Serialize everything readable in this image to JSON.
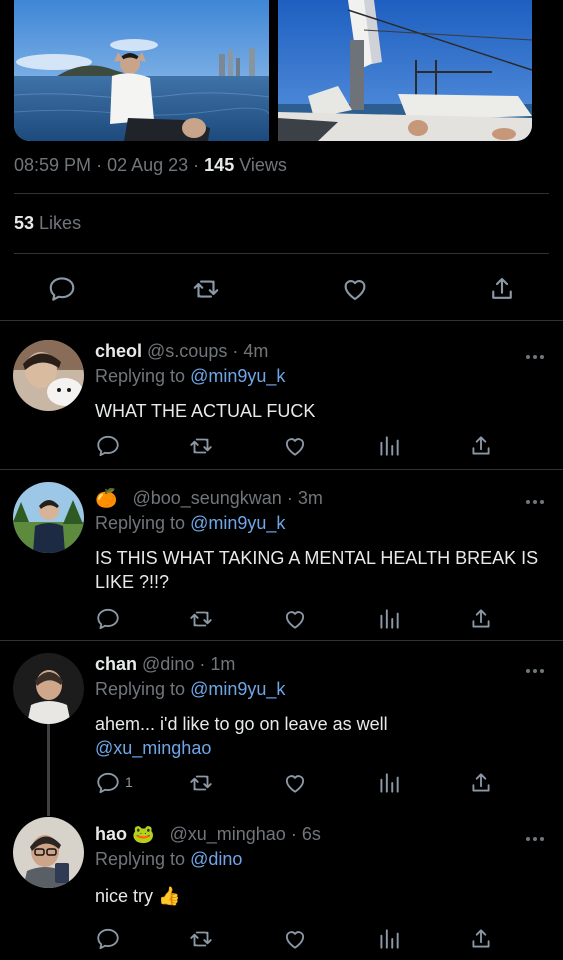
{
  "tweet": {
    "time": "08:59 PM",
    "date": "02 Aug 23",
    "views_count": "145",
    "views_label": "Views",
    "likes_count": "53",
    "likes_label": "Likes"
  },
  "replies": [
    {
      "name": "cheol",
      "handle": "@s.coups",
      "time": "4m",
      "replying_label": "Replying to",
      "replying_to": "@min9yu_k",
      "text": "WHAT THE ACTUAL FUCK"
    },
    {
      "name": "",
      "name_emoji": "🍊",
      "handle": "@boo_seungkwan",
      "time": "3m",
      "replying_label": "Replying to",
      "replying_to": "@min9yu_k",
      "text": "IS THIS WHAT TAKING A MENTAL HEALTH BREAK IS LIKE ?!!?"
    },
    {
      "name": "chan",
      "handle": "@dino",
      "time": "1m",
      "replying_label": "Replying to",
      "replying_to": "@min9yu_k",
      "text": "ahem... i'd like to go on leave as well",
      "mention": "@xu_minghao",
      "reply_count": "1"
    },
    {
      "name": "hao",
      "name_emoji": "🐸",
      "handle": "@xu_minghao",
      "time": "6s",
      "replying_label": "Replying to",
      "replying_to": "@dino",
      "text": "nice try",
      "text_emoji": "👍"
    }
  ],
  "colors": {
    "background": "#000000",
    "text": "#e7e9ea",
    "muted": "#71767b",
    "link": "#6ea6e8",
    "divider": "#2f3336"
  },
  "icons": [
    "reply-icon",
    "retweet-icon",
    "like-icon",
    "views-icon",
    "share-icon",
    "more-icon"
  ]
}
